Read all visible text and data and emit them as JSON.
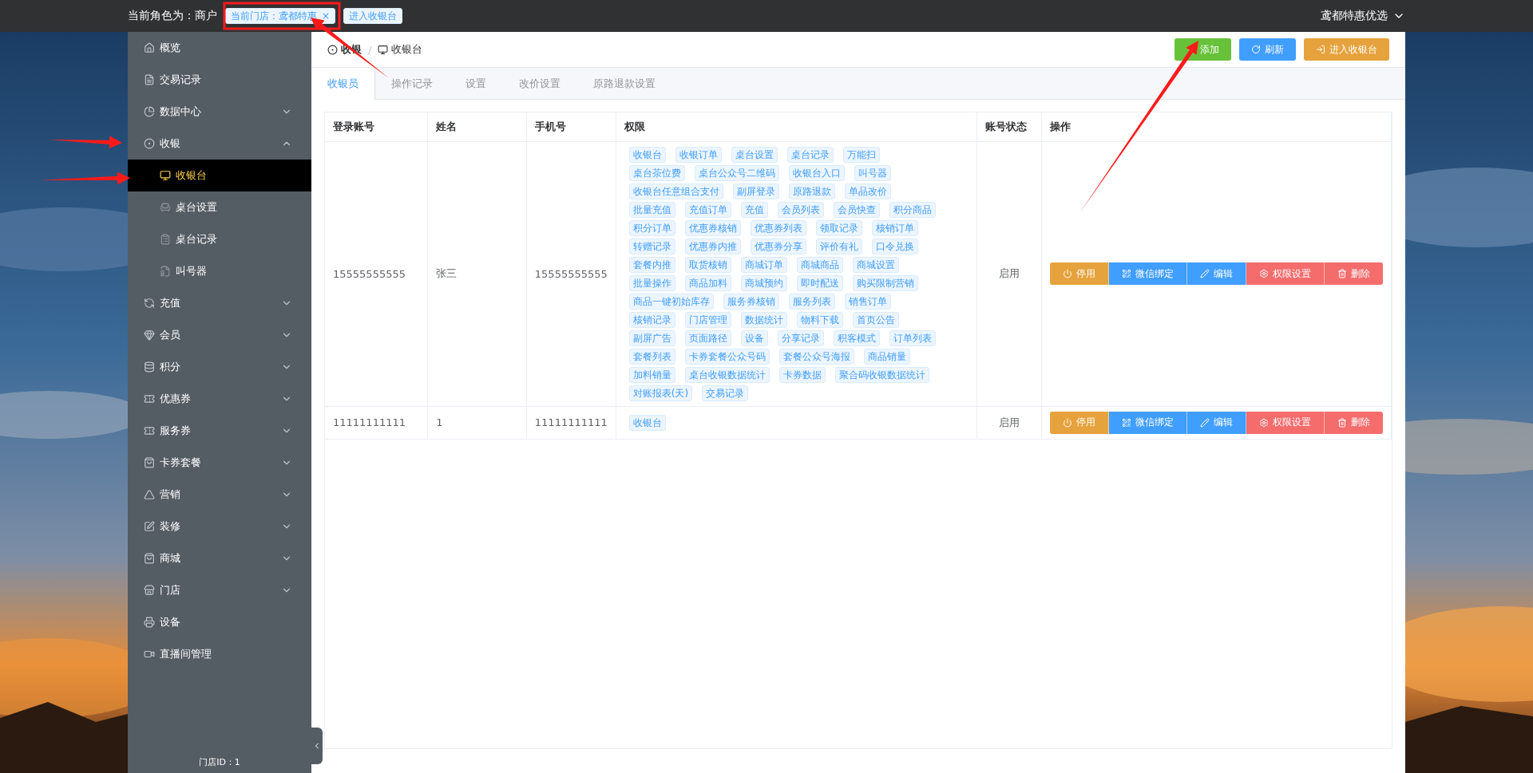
{
  "topbar": {
    "role": "当前角色为：商户",
    "store_tag": {
      "label": "当前门店：鸢都特惠",
      "close": "×"
    },
    "enter_tag": "进入收银台",
    "user": "鸢都特惠优选"
  },
  "sidebar": {
    "items": [
      {
        "label": "概览",
        "selected": false
      },
      {
        "label": "交易记录",
        "selected": false
      },
      {
        "label": "数据中心",
        "selected": false,
        "expanded": false
      },
      {
        "label": "收银",
        "selected": false,
        "expanded": true,
        "children": [
          {
            "label": "收银台",
            "selected": true
          },
          {
            "label": "桌台设置",
            "selected": false
          },
          {
            "label": "桌台记录",
            "selected": false
          },
          {
            "label": "叫号器",
            "selected": false
          }
        ]
      },
      {
        "label": "充值",
        "selected": false,
        "expanded": false
      },
      {
        "label": "会员",
        "selected": false,
        "expanded": false
      },
      {
        "label": "积分",
        "selected": false,
        "expanded": false
      },
      {
        "label": "优惠券",
        "selected": false,
        "expanded": false
      },
      {
        "label": "服务券",
        "selected": false,
        "expanded": false
      },
      {
        "label": "卡券套餐",
        "selected": false,
        "expanded": false
      },
      {
        "label": "营销",
        "selected": false,
        "expanded": false
      },
      {
        "label": "装修",
        "selected": false,
        "expanded": false
      },
      {
        "label": "商城",
        "selected": false,
        "expanded": false
      },
      {
        "label": "门店",
        "selected": false,
        "expanded": false
      },
      {
        "label": "设备",
        "selected": false
      },
      {
        "label": "直播间管理",
        "selected": false
      }
    ],
    "footer": "门店ID：1"
  },
  "breadcrumb": {
    "items": [
      "收银",
      "收银台"
    ],
    "separator": "/"
  },
  "toolbar": [
    {
      "label": "添加",
      "kind": "add"
    },
    {
      "label": "刷新",
      "kind": "refresh"
    },
    {
      "label": "进入收银台",
      "kind": "enter"
    }
  ],
  "tabs": [
    {
      "label": "收银员",
      "selected": true
    },
    {
      "label": "操作记录",
      "selected": false
    },
    {
      "label": "设置",
      "selected": false
    },
    {
      "label": "改价设置",
      "selected": false
    },
    {
      "label": "原路退款设置",
      "selected": false
    }
  ],
  "table": {
    "columns": [
      "登录账号",
      "姓名",
      "手机号",
      "权限",
      "账号状态",
      "操作"
    ],
    "rows": [
      {
        "account": "15555555555",
        "name": "张三",
        "phone": "15555555555",
        "permissions": [
          "收银台",
          "收银订单",
          "桌台设置",
          "桌台记录",
          "万能扫",
          "桌台茶位费",
          "桌台公众号二维码",
          "收银台入口",
          "叫号器",
          "收银台任意组合支付",
          "副屏登录",
          "原路退款",
          "单品改价",
          "批量充值",
          "充值订单",
          "充值",
          "会员列表",
          "会员快查",
          "积分商品",
          "积分订单",
          "优惠券核销",
          "优惠券列表",
          "领取记录",
          "核销订单",
          "转赠记录",
          "优惠券内推",
          "优惠券分享",
          "评价有礼",
          "口令兑换",
          "套餐内推",
          "取货核销",
          "商城订单",
          "商城商品",
          "商城设置",
          "批量操作",
          "商品加料",
          "商城预约",
          "即时配送",
          "购买限制营销",
          "商品一键初始库存",
          "服务券核销",
          "服务列表",
          "销售订单",
          "核销记录",
          "门店管理",
          "数据统计",
          "物料下载",
          "首页公告",
          "副屏广告",
          "页面路径",
          "设备",
          "分享记录",
          "积客模式",
          "订单列表",
          "套餐列表",
          "卡券套餐公众号码",
          "套餐公众号海报",
          "商品销量",
          "加料销量",
          "桌台收银数据统计",
          "卡券数据",
          "聚合码收银数据统计",
          "对账报表(天)",
          "交易记录"
        ],
        "status": "启用",
        "actions": [
          {
            "label": "停用",
            "kind": "disable"
          },
          {
            "label": "微信绑定",
            "kind": "wechat"
          },
          {
            "label": "编辑",
            "kind": "edit"
          },
          {
            "label": "权限设置",
            "kind": "permission"
          },
          {
            "label": "删除",
            "kind": "delete"
          }
        ]
      },
      {
        "account": "11111111111",
        "name": "1",
        "phone": "11111111111",
        "permissions": [
          "收银台"
        ],
        "status": "启用",
        "actions": [
          {
            "label": "停用",
            "kind": "disable"
          },
          {
            "label": "微信绑定",
            "kind": "wechat"
          },
          {
            "label": "编辑",
            "kind": "edit"
          },
          {
            "label": "权限设置",
            "kind": "permission"
          },
          {
            "label": "删除",
            "kind": "delete"
          }
        ]
      }
    ]
  },
  "annotations": [
    {
      "kind": "frame"
    },
    {
      "kind": "arrow"
    },
    {
      "kind": "arrow"
    },
    {
      "kind": "arrow"
    },
    {
      "kind": "arrow"
    }
  ]
}
